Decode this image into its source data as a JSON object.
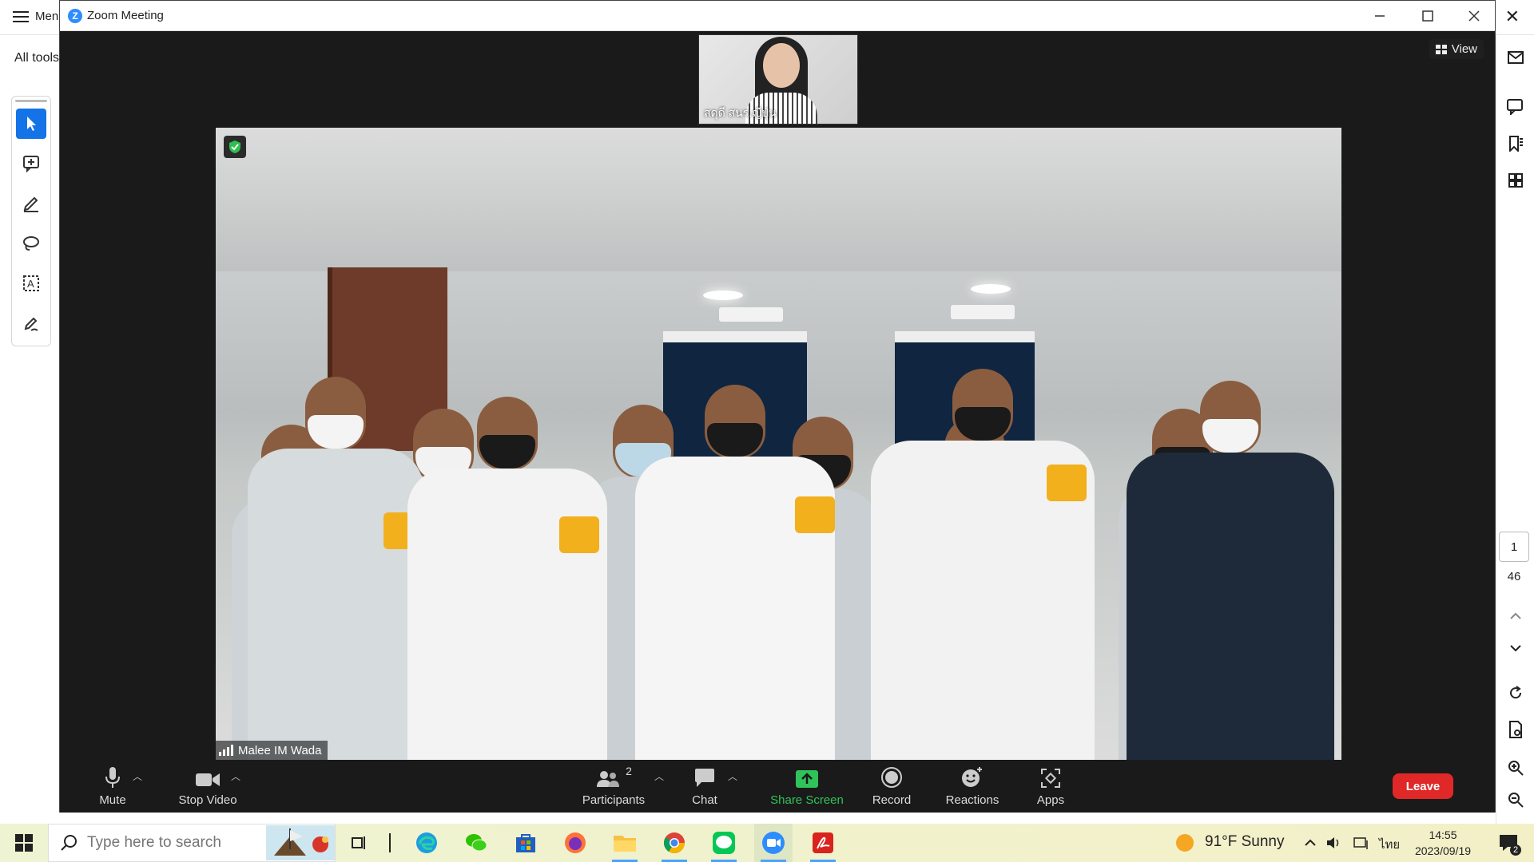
{
  "background_app": {
    "menu_label": "Menu",
    "all_tools": "All tools",
    "page_current": "1",
    "page_total": "46"
  },
  "zoom": {
    "window_title": "Zoom Meeting",
    "view_label": "View",
    "thumbnail_name": "สดุดี สนร.ญี่ปุ่น",
    "main_video_name": "Malee IM Wada",
    "toolbar": {
      "mute": "Mute",
      "stop_video": "Stop Video",
      "participants": "Participants",
      "participants_count": "2",
      "chat": "Chat",
      "share_screen": "Share Screen",
      "record": "Record",
      "reactions": "Reactions",
      "apps": "Apps",
      "leave": "Leave"
    },
    "colors": {
      "share_green": "#30c35a",
      "leave_red": "#e02828",
      "accent_blue": "#2d8cff"
    }
  },
  "taskbar": {
    "search_placeholder": "Type here to search",
    "weather": "91°F  Sunny",
    "language": "ไทย",
    "time": "14:55",
    "date": "2023/09/19",
    "notification_count": "2",
    "apps": [
      "task-view",
      "divider",
      "edge",
      "wechat",
      "store",
      "firefox",
      "file-explorer",
      "chrome",
      "line",
      "zoom",
      "acrobat"
    ]
  }
}
